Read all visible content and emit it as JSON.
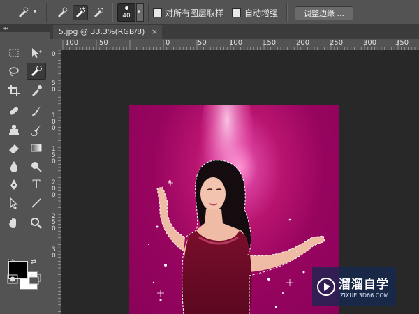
{
  "options_bar": {
    "brush_size": "40",
    "sample_all_layers_label": "对所有图层取样",
    "auto_enhance_label": "自动增强",
    "refine_edge_label": "调整边缘 ..."
  },
  "toolbox": {
    "collapse_label": "◂◂"
  },
  "document": {
    "tab_title": "5.jpg @ 33.3%(RGB/8)",
    "close_label": "×"
  },
  "ruler_top": [
    "100",
    "50",
    "0",
    "50",
    "100",
    "150",
    "200",
    "250",
    "300",
    "350",
    "400"
  ],
  "ruler_left": [
    "0",
    "5",
    "0",
    "1",
    "0",
    "0",
    "1",
    "5",
    "0",
    "2",
    "0",
    "0",
    "2",
    "5",
    "0",
    "3",
    "0"
  ],
  "watermark": {
    "title": "溜溜自学",
    "url": "ZIXUE.3D66.COM"
  },
  "colors": {
    "foreground": "#000000",
    "background": "#ffffff",
    "photo_magenta": "#97045f"
  }
}
